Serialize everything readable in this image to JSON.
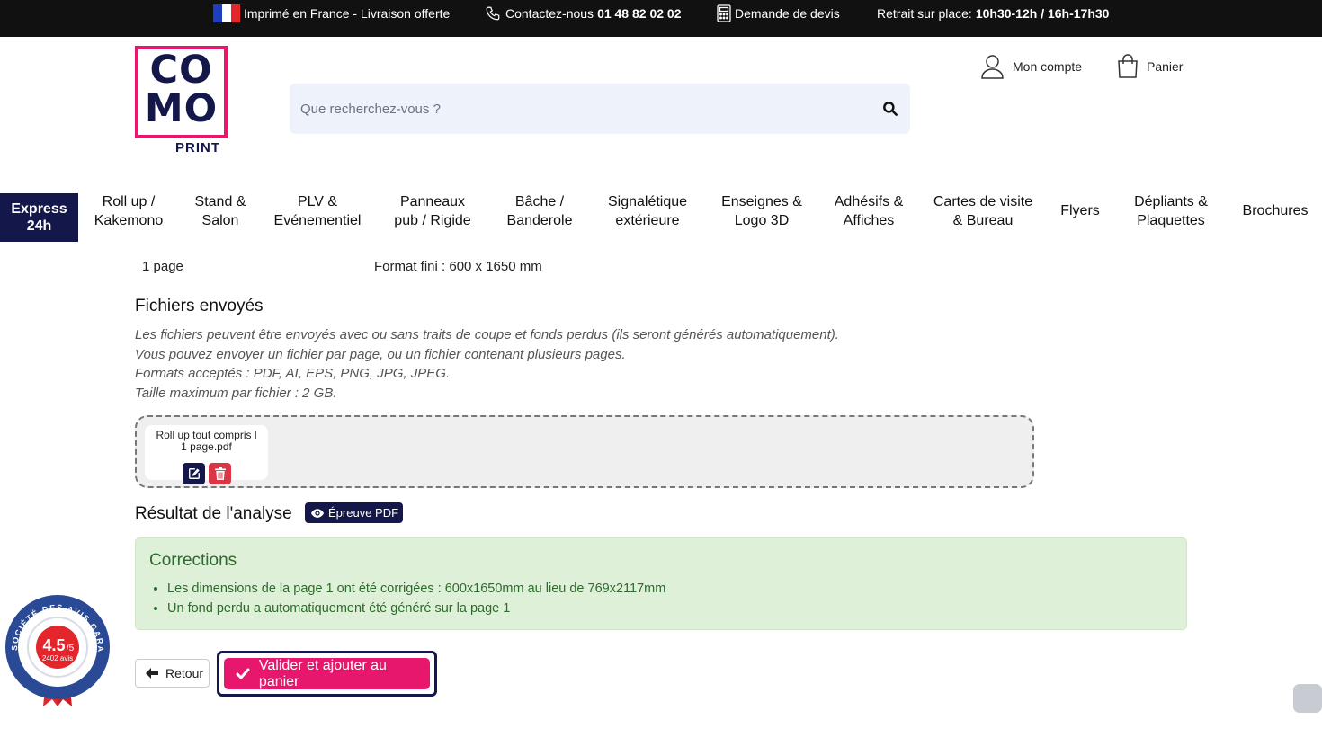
{
  "topbar": {
    "made_in_france": "Imprimé en France - Livraison offerte",
    "contact_prefix": "Contactez-nous ",
    "contact_phone": "01 48 82 02 02",
    "quote": "Demande de devis",
    "pickup_prefix": "Retrait sur place: ",
    "pickup_hours": "10h30-12h / 16h-17h30",
    "flag_colors": [
      "#1f3fbf",
      "#ffffff",
      "#e3262b"
    ]
  },
  "logo": {
    "line1": "CO",
    "line2": "MO",
    "line3": "PRINT",
    "border_color": "#e6176c",
    "text_color": "#14174a"
  },
  "search": {
    "placeholder": "Que recherchez-vous ?"
  },
  "account": {
    "label": "Mon compte"
  },
  "cart": {
    "label": "Panier"
  },
  "nav": {
    "express_line1": "Express",
    "express_line2": "24h",
    "items": [
      {
        "line1": "Roll up /",
        "line2": "Kakemono"
      },
      {
        "line1": "Stand &",
        "line2": "Salon"
      },
      {
        "line1": "PLV &",
        "line2": "Evénementiel"
      },
      {
        "line1": "Panneaux",
        "line2": "pub / Rigide"
      },
      {
        "line1": "Bâche /",
        "line2": "Banderole"
      },
      {
        "line1": "Signalétique",
        "line2": "extérieure"
      },
      {
        "line1": "Enseignes &",
        "line2": "Logo 3D"
      },
      {
        "line1": "Adhésifs &",
        "line2": "Affiches"
      },
      {
        "line1": "Cartes de visite",
        "line2": "& Bureau"
      },
      {
        "line1": "Flyers",
        "line2": ""
      },
      {
        "line1": "Dépliants &",
        "line2": "Plaquettes"
      },
      {
        "line1": "Brochures",
        "line2": ""
      }
    ]
  },
  "summary": {
    "pages": "1 page",
    "format": "Format fini : 600 x 1650 mm"
  },
  "files": {
    "heading": "Fichiers envoyés",
    "notes": [
      "Les fichiers peuvent être envoyés avec ou sans traits de coupe et fonds perdus (ils seront générés automatiquement).",
      "Vous pouvez envoyer un fichier par page, ou un fichier contenant plusieurs pages.",
      "Formats acceptés : PDF, AI, EPS, PNG, JPG, JPEG.",
      "Taille maximum par fichier : 2 GB."
    ],
    "uploaded_line1": "Roll up tout compris l",
    "uploaded_line2": "1 page.pdf"
  },
  "analysis": {
    "heading": "Résultat de l'analyse",
    "proof_button": "Épreuve PDF"
  },
  "corrections": {
    "title": "Corrections",
    "items": [
      "Les dimensions de la page 1 ont été corrigées : 600x1650mm au lieu de 769x2117mm",
      "Un fond perdu a automatiquement été généré sur la page 1"
    ]
  },
  "actions": {
    "back": "Retour",
    "validate": "Valider et ajouter au panier"
  },
  "reviews_badge": {
    "arc_text": "SOCIÉTÉ DES AVIS GARANTIS",
    "score": "4.5",
    "scale": "/5",
    "count": "2402 avis"
  },
  "colors": {
    "brand_navy": "#14174a",
    "brand_pink": "#e6176c",
    "success_bg": "#dff0d8",
    "success_text": "#2d6a2d"
  }
}
